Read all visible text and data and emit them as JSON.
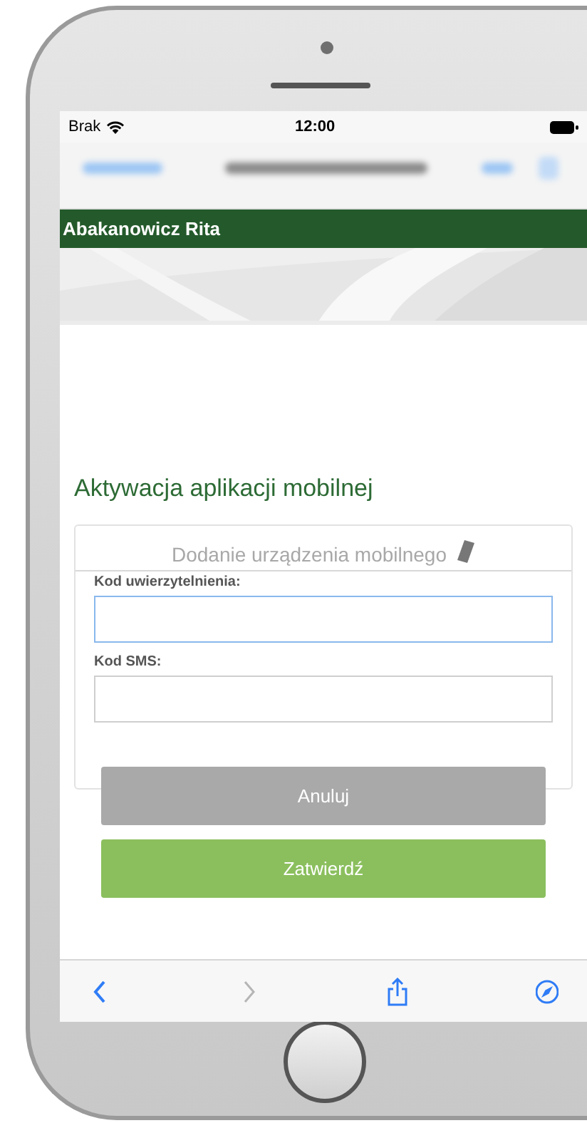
{
  "status_bar": {
    "carrier": "Brak",
    "time": "12:00"
  },
  "header": {
    "user_name": "Abakanowicz Rita"
  },
  "page_title": "Aktywacja aplikacji mobilnej",
  "card": {
    "title": "Dodanie urządzenia mobilnego",
    "fields": [
      {
        "label": "Kod uwierzytelnienia:",
        "focused": true
      },
      {
        "label": "Kod SMS:",
        "focused": false
      }
    ]
  },
  "buttons": [
    {
      "label": "Anuluj",
      "kind": "secondary"
    },
    {
      "label": "Zatwierdź",
      "kind": "primary"
    }
  ],
  "toolbar": [
    {
      "kind": "back",
      "disabled": false
    },
    {
      "kind": "forward",
      "disabled": true
    },
    {
      "kind": "share",
      "disabled": false
    },
    {
      "kind": "compass",
      "disabled": false
    }
  ]
}
